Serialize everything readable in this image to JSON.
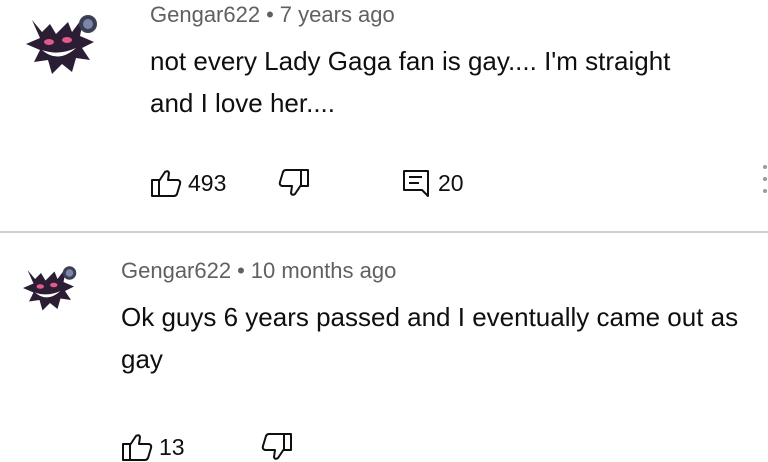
{
  "comments": [
    {
      "author": "Gengar622",
      "separator": "•",
      "time": "7 years ago",
      "text": "not every Lady Gaga fan is gay.... I'm straight and I love her....",
      "likes": "493",
      "replies": "20",
      "avatar_icon": "gengar-avatar-icon"
    },
    {
      "author": "Gengar622",
      "separator": "•",
      "time": "10 months ago",
      "text": "Ok guys 6 years passed and I eventually came out as gay",
      "likes": "13",
      "avatar_icon": "gengar-avatar-icon"
    }
  ],
  "colors": {
    "meta": "#606060",
    "text": "#0f0f0f",
    "divider": "#cfcfcf",
    "avatar": "#2b1d33"
  }
}
